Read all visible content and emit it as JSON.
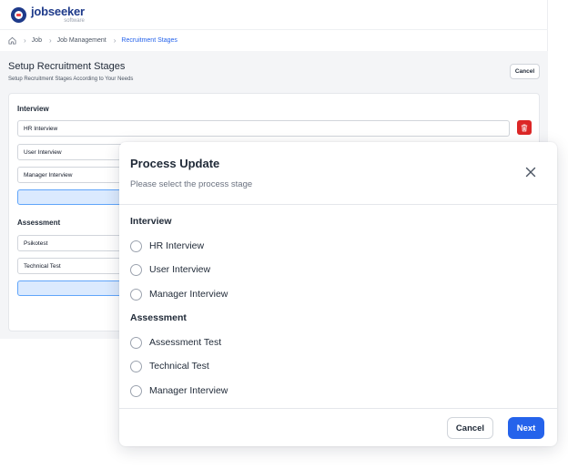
{
  "brand": {
    "name": "jobseeker",
    "tagline": "software",
    "colors": {
      "primary": "#1e3a8a",
      "accent": "#2563eb",
      "danger": "#dc2626"
    }
  },
  "breadcrumb": {
    "home_icon": "home-icon",
    "items": [
      "Job",
      "Job Management",
      "Recruitment Stages"
    ]
  },
  "page": {
    "title": "Setup Recruitment Stages",
    "subtitle": "Setup Recruitment Stages According to Your Needs",
    "cancel_label": "Cancel"
  },
  "stages": {
    "interview": {
      "title": "Interview",
      "fields": [
        "HR Interview",
        "User Interview",
        "Manager Interview"
      ]
    },
    "assessment": {
      "title": "Assessment",
      "fields": [
        "Psikotest",
        "Technical Test"
      ]
    }
  },
  "modal": {
    "title": "Process Update",
    "subtitle": "Please select the process stage",
    "close_icon": "close-icon",
    "groups": [
      {
        "title": "Interview",
        "options": [
          "HR Interview",
          "User Interview",
          "Manager Interview"
        ]
      },
      {
        "title": "Assessment",
        "options": [
          "Assessment Test",
          "Technical Test",
          "Manager Interview"
        ]
      }
    ],
    "cancel_label": "Cancel",
    "next_label": "Next"
  }
}
